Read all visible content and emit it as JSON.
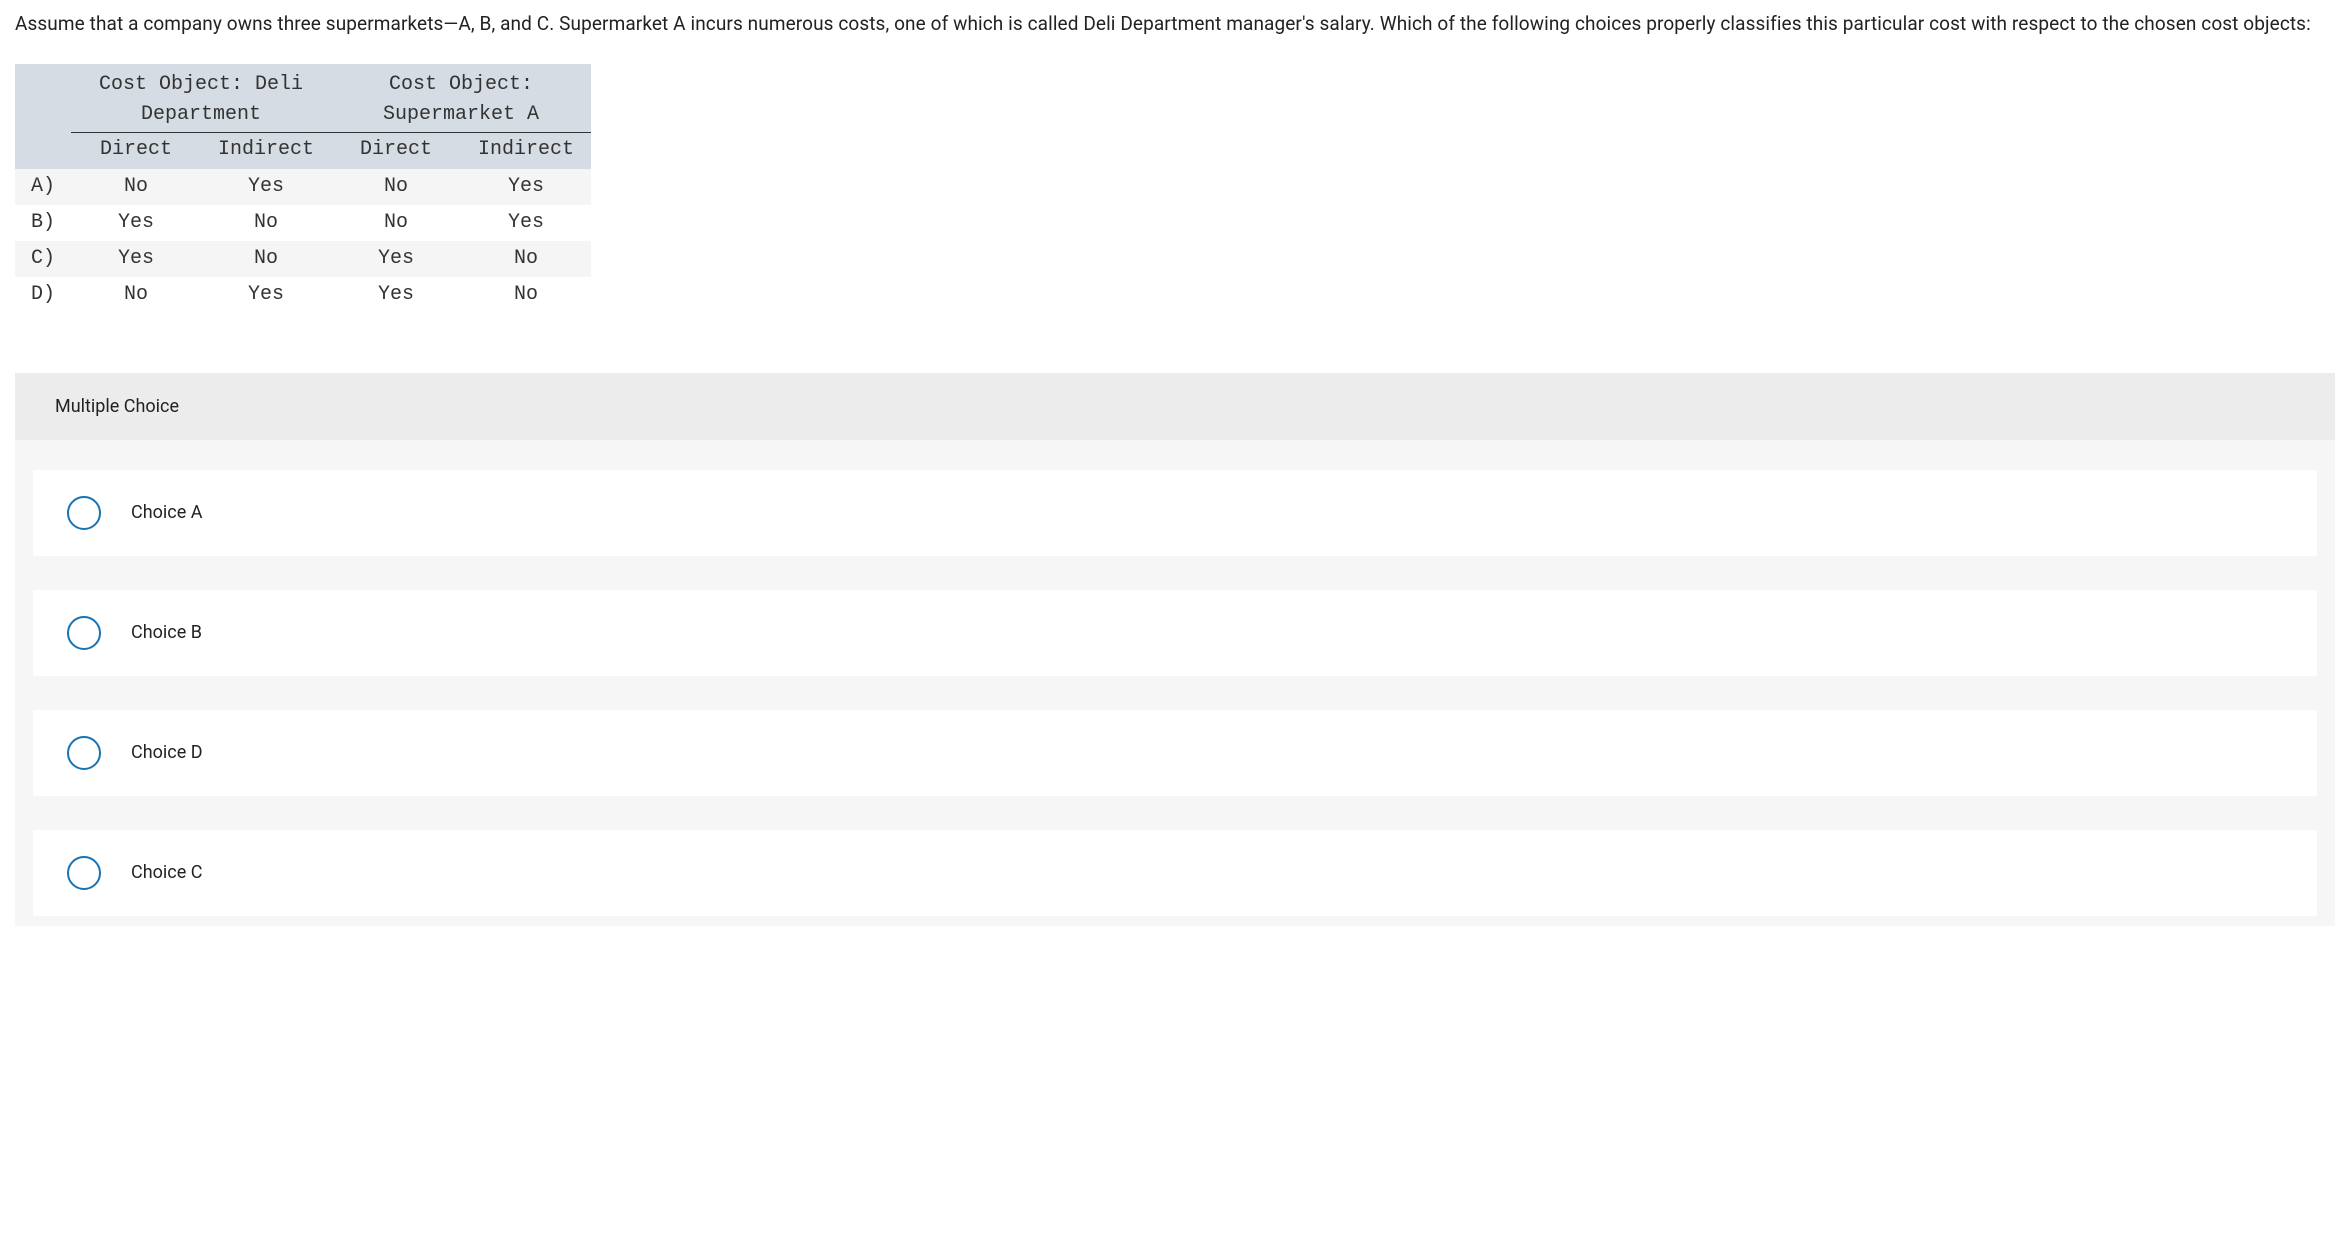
{
  "question": "Assume that a company owns three supermarkets—A, B, and C. Supermarket A incurs numerous costs, one of which is called Deli Department manager's salary. Which of the following choices properly classifies this particular cost with respect to the chosen cost objects:",
  "table": {
    "group_headers": {
      "left_line1": "Cost Object: Deli",
      "left_line2": "Department",
      "right_line1": "Cost Object:",
      "right_line2": "Supermarket A"
    },
    "sub_headers": [
      "Direct",
      "Indirect",
      "Direct",
      "Indirect"
    ],
    "rows": [
      {
        "label": "A)",
        "cells": [
          "No",
          "Yes",
          "No",
          "Yes"
        ]
      },
      {
        "label": "B)",
        "cells": [
          "Yes",
          "No",
          "No",
          "Yes"
        ]
      },
      {
        "label": "C)",
        "cells": [
          "Yes",
          "No",
          "Yes",
          "No"
        ]
      },
      {
        "label": "D)",
        "cells": [
          "No",
          "Yes",
          "Yes",
          "No"
        ]
      }
    ]
  },
  "mc_header": "Multiple Choice",
  "choices": [
    {
      "label": "Choice A"
    },
    {
      "label": "Choice B"
    },
    {
      "label": "Choice D"
    },
    {
      "label": "Choice C"
    }
  ]
}
